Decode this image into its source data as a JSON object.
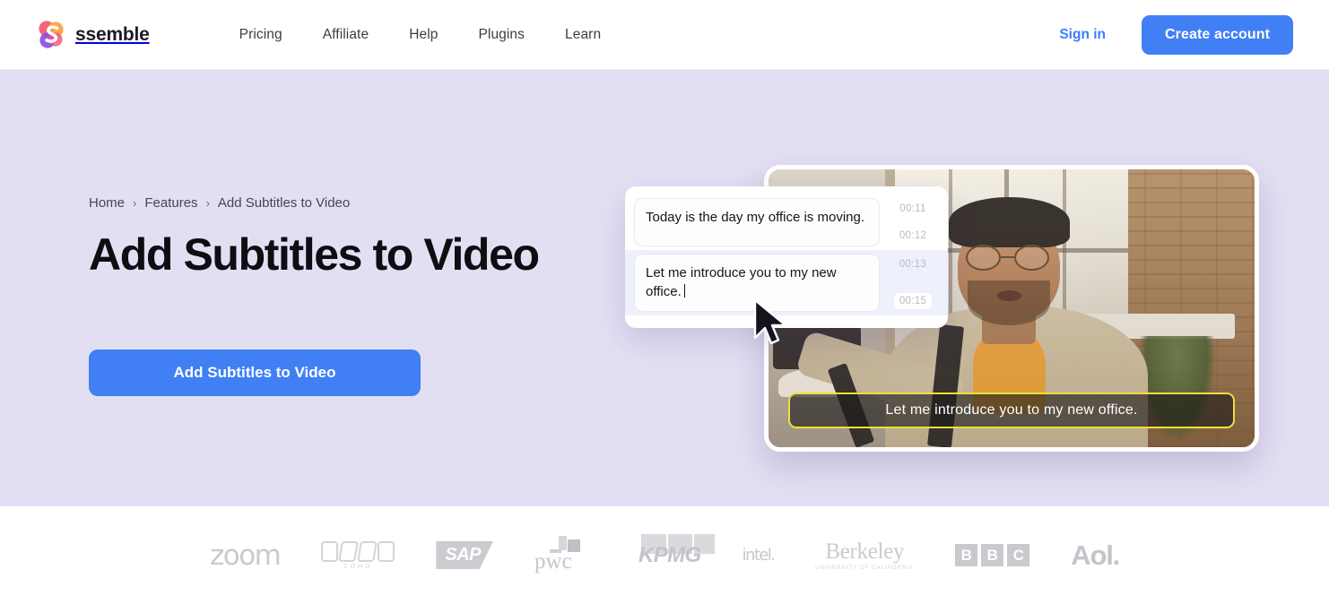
{
  "header": {
    "brand_name": "ssemble",
    "brand_icon": "ssemble-logo-icon",
    "nav": [
      {
        "label": "Pricing"
      },
      {
        "label": "Affiliate"
      },
      {
        "label": "Help"
      },
      {
        "label": "Plugins"
      },
      {
        "label": "Learn"
      }
    ],
    "sign_in_label": "Sign in",
    "create_account_label": "Create account"
  },
  "hero": {
    "breadcrumb": [
      {
        "label": "Home"
      },
      {
        "label": "Features"
      },
      {
        "label": "Add Subtitles to Video"
      }
    ],
    "breadcrumb_separator": "›",
    "title": "Add Subtitles to Video",
    "cta_label": "Add Subtitles to Video",
    "background_color": "#e3dff3",
    "accent_color": "#417ff5"
  },
  "subtitle_editor": {
    "rows": [
      {
        "text": "Today is the day my office is moving.",
        "start": "00:11",
        "end": "00:12",
        "active": false
      },
      {
        "text": "Let me introduce you to my new office.",
        "start": "00:13",
        "end": "00:15",
        "active": true
      }
    ]
  },
  "video": {
    "subtitle_overlay": "Let me introduce you to my new office.",
    "subtitle_border_color": "#ece03a",
    "scene_description": "man-in-beanie-and-glasses-selfie-in-loft-office"
  },
  "cursor": {
    "icon": "mouse-pointer-arrow-icon"
  },
  "logos": {
    "items": [
      {
        "name": "zoom",
        "label": "zoom"
      },
      {
        "name": "zoho",
        "label": "ZOHO"
      },
      {
        "name": "sap",
        "label": "SAP"
      },
      {
        "name": "pwc",
        "label": "pwc"
      },
      {
        "name": "kpmg",
        "label": "KPMG"
      },
      {
        "name": "intel",
        "label": "intel"
      },
      {
        "name": "berkeley",
        "label": "Berkeley",
        "sublabel": "UNIVERSITY OF CALIFORNIA"
      },
      {
        "name": "bbc",
        "label": "BBC",
        "letters": [
          "B",
          "B",
          "C"
        ]
      },
      {
        "name": "aol",
        "label": "Aol."
      }
    ]
  }
}
